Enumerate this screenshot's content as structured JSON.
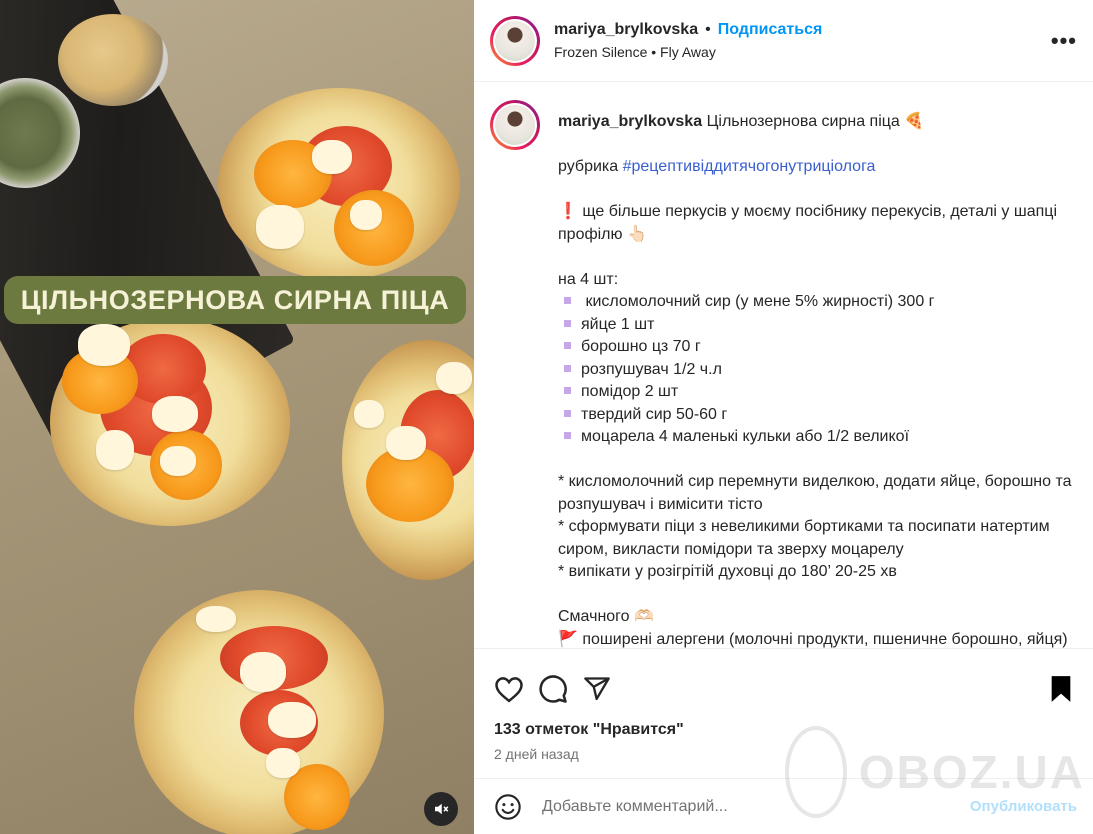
{
  "media": {
    "banner_text": "ЦІЛЬНОЗЕРНОВА СИРНА ПІЦА",
    "mute_icon": "speaker-muted-icon"
  },
  "header": {
    "username": "mariya_brylkovska",
    "separator": "•",
    "follow_label": "Подписаться",
    "audio": "Frozen Silence • Fly Away",
    "more_label": "•••"
  },
  "caption": {
    "username": "mariya_brylkovska",
    "title": "Цільнозернова сирна піца 🍕",
    "rubric_prefix": "рубрика",
    "hashtag": "#рецептивiддитячогонутриціолога",
    "promo": "❗ ще більше перкусів у моєму посібнику перекусів, деталі у шапці профілю 👆🏻",
    "servings": "на 4 шт:",
    "ingredients": [
      " кисломолочний сир (у мене 5% жирності) 300 г",
      "яйце 1 шт",
      "борошно цз 70 г",
      "розпушувач 1/2 ч.л",
      "помідор 2 шт",
      "твердий сир 50-60 г",
      "моцарела 4 маленькі кульки або 1/2 великої"
    ],
    "steps": [
      "* кисломолочний сир перемнути виделкою, додати яйце, борошно та розпушувач і вимісити тісто",
      "* сформувати піци з невеликими бортиками та посипати натертим сиром, викласти помідори та зверху моцарелу",
      "* випікати у розігрітій духовці до 180’ 20-25 хв"
    ],
    "closing": "Смачного 🫶🏻",
    "allergens": "🚩 поширені алергени (молочні продукти, пшеничне борошно, яйця)"
  },
  "actions": {
    "like_icon": "heart-icon",
    "comment_icon": "comment-icon",
    "share_icon": "share-icon",
    "save_icon": "bookmark-icon",
    "likes_text": "133 отметок \"Нравится\"",
    "time_text": "2 дней назад"
  },
  "comment": {
    "placeholder": "Добавьте комментарий...",
    "post_label": "Опубликовать"
  },
  "watermark": {
    "text": "OBOZ.UA"
  }
}
